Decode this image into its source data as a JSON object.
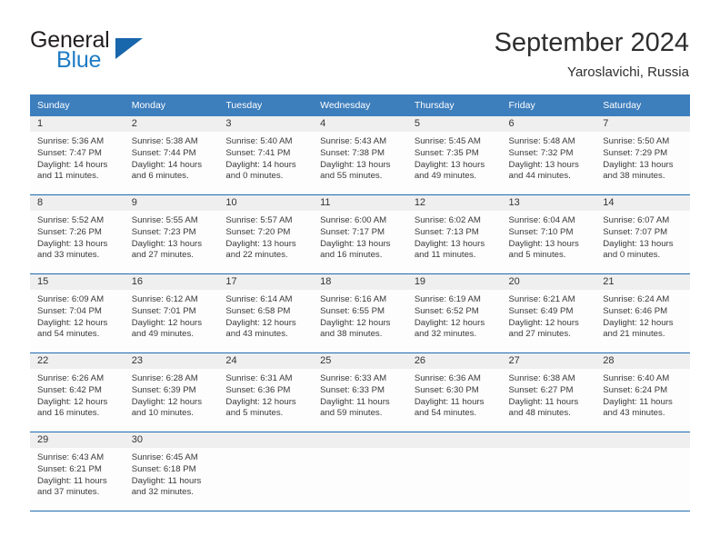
{
  "brand": {
    "name_top": "General",
    "name_bottom": "Blue",
    "triangle_color": "#1866ab",
    "blue_color": "#1e7bc4"
  },
  "header": {
    "title": "September 2024",
    "subtitle": "Yaroslavichi, Russia"
  },
  "theme": {
    "header_bg": "#3d7ebd",
    "row_divider": "#1e6bb0",
    "daynum_band": "#efefef"
  },
  "calendar": {
    "weekday_headers": [
      "Sunday",
      "Monday",
      "Tuesday",
      "Wednesday",
      "Thursday",
      "Friday",
      "Saturday"
    ],
    "weeks": [
      [
        {
          "day": "1",
          "sunrise": "Sunrise: 5:36 AM",
          "sunset": "Sunset: 7:47 PM",
          "daylight": "Daylight: 14 hours and 11 minutes."
        },
        {
          "day": "2",
          "sunrise": "Sunrise: 5:38 AM",
          "sunset": "Sunset: 7:44 PM",
          "daylight": "Daylight: 14 hours and 6 minutes."
        },
        {
          "day": "3",
          "sunrise": "Sunrise: 5:40 AM",
          "sunset": "Sunset: 7:41 PM",
          "daylight": "Daylight: 14 hours and 0 minutes."
        },
        {
          "day": "4",
          "sunrise": "Sunrise: 5:43 AM",
          "sunset": "Sunset: 7:38 PM",
          "daylight": "Daylight: 13 hours and 55 minutes."
        },
        {
          "day": "5",
          "sunrise": "Sunrise: 5:45 AM",
          "sunset": "Sunset: 7:35 PM",
          "daylight": "Daylight: 13 hours and 49 minutes."
        },
        {
          "day": "6",
          "sunrise": "Sunrise: 5:48 AM",
          "sunset": "Sunset: 7:32 PM",
          "daylight": "Daylight: 13 hours and 44 minutes."
        },
        {
          "day": "7",
          "sunrise": "Sunrise: 5:50 AM",
          "sunset": "Sunset: 7:29 PM",
          "daylight": "Daylight: 13 hours and 38 minutes."
        }
      ],
      [
        {
          "day": "8",
          "sunrise": "Sunrise: 5:52 AM",
          "sunset": "Sunset: 7:26 PM",
          "daylight": "Daylight: 13 hours and 33 minutes."
        },
        {
          "day": "9",
          "sunrise": "Sunrise: 5:55 AM",
          "sunset": "Sunset: 7:23 PM",
          "daylight": "Daylight: 13 hours and 27 minutes."
        },
        {
          "day": "10",
          "sunrise": "Sunrise: 5:57 AM",
          "sunset": "Sunset: 7:20 PM",
          "daylight": "Daylight: 13 hours and 22 minutes."
        },
        {
          "day": "11",
          "sunrise": "Sunrise: 6:00 AM",
          "sunset": "Sunset: 7:17 PM",
          "daylight": "Daylight: 13 hours and 16 minutes."
        },
        {
          "day": "12",
          "sunrise": "Sunrise: 6:02 AM",
          "sunset": "Sunset: 7:13 PM",
          "daylight": "Daylight: 13 hours and 11 minutes."
        },
        {
          "day": "13",
          "sunrise": "Sunrise: 6:04 AM",
          "sunset": "Sunset: 7:10 PM",
          "daylight": "Daylight: 13 hours and 5 minutes."
        },
        {
          "day": "14",
          "sunrise": "Sunrise: 6:07 AM",
          "sunset": "Sunset: 7:07 PM",
          "daylight": "Daylight: 13 hours and 0 minutes."
        }
      ],
      [
        {
          "day": "15",
          "sunrise": "Sunrise: 6:09 AM",
          "sunset": "Sunset: 7:04 PM",
          "daylight": "Daylight: 12 hours and 54 minutes."
        },
        {
          "day": "16",
          "sunrise": "Sunrise: 6:12 AM",
          "sunset": "Sunset: 7:01 PM",
          "daylight": "Daylight: 12 hours and 49 minutes."
        },
        {
          "day": "17",
          "sunrise": "Sunrise: 6:14 AM",
          "sunset": "Sunset: 6:58 PM",
          "daylight": "Daylight: 12 hours and 43 minutes."
        },
        {
          "day": "18",
          "sunrise": "Sunrise: 6:16 AM",
          "sunset": "Sunset: 6:55 PM",
          "daylight": "Daylight: 12 hours and 38 minutes."
        },
        {
          "day": "19",
          "sunrise": "Sunrise: 6:19 AM",
          "sunset": "Sunset: 6:52 PM",
          "daylight": "Daylight: 12 hours and 32 minutes."
        },
        {
          "day": "20",
          "sunrise": "Sunrise: 6:21 AM",
          "sunset": "Sunset: 6:49 PM",
          "daylight": "Daylight: 12 hours and 27 minutes."
        },
        {
          "day": "21",
          "sunrise": "Sunrise: 6:24 AM",
          "sunset": "Sunset: 6:46 PM",
          "daylight": "Daylight: 12 hours and 21 minutes."
        }
      ],
      [
        {
          "day": "22",
          "sunrise": "Sunrise: 6:26 AM",
          "sunset": "Sunset: 6:42 PM",
          "daylight": "Daylight: 12 hours and 16 minutes."
        },
        {
          "day": "23",
          "sunrise": "Sunrise: 6:28 AM",
          "sunset": "Sunset: 6:39 PM",
          "daylight": "Daylight: 12 hours and 10 minutes."
        },
        {
          "day": "24",
          "sunrise": "Sunrise: 6:31 AM",
          "sunset": "Sunset: 6:36 PM",
          "daylight": "Daylight: 12 hours and 5 minutes."
        },
        {
          "day": "25",
          "sunrise": "Sunrise: 6:33 AM",
          "sunset": "Sunset: 6:33 PM",
          "daylight": "Daylight: 11 hours and 59 minutes."
        },
        {
          "day": "26",
          "sunrise": "Sunrise: 6:36 AM",
          "sunset": "Sunset: 6:30 PM",
          "daylight": "Daylight: 11 hours and 54 minutes."
        },
        {
          "day": "27",
          "sunrise": "Sunrise: 6:38 AM",
          "sunset": "Sunset: 6:27 PM",
          "daylight": "Daylight: 11 hours and 48 minutes."
        },
        {
          "day": "28",
          "sunrise": "Sunrise: 6:40 AM",
          "sunset": "Sunset: 6:24 PM",
          "daylight": "Daylight: 11 hours and 43 minutes."
        }
      ],
      [
        {
          "day": "29",
          "sunrise": "Sunrise: 6:43 AM",
          "sunset": "Sunset: 6:21 PM",
          "daylight": "Daylight: 11 hours and 37 minutes."
        },
        {
          "day": "30",
          "sunrise": "Sunrise: 6:45 AM",
          "sunset": "Sunset: 6:18 PM",
          "daylight": "Daylight: 11 hours and 32 minutes."
        },
        {
          "day": "",
          "sunrise": "",
          "sunset": "",
          "daylight": ""
        },
        {
          "day": "",
          "sunrise": "",
          "sunset": "",
          "daylight": ""
        },
        {
          "day": "",
          "sunrise": "",
          "sunset": "",
          "daylight": ""
        },
        {
          "day": "",
          "sunrise": "",
          "sunset": "",
          "daylight": ""
        },
        {
          "day": "",
          "sunrise": "",
          "sunset": "",
          "daylight": ""
        }
      ]
    ]
  }
}
